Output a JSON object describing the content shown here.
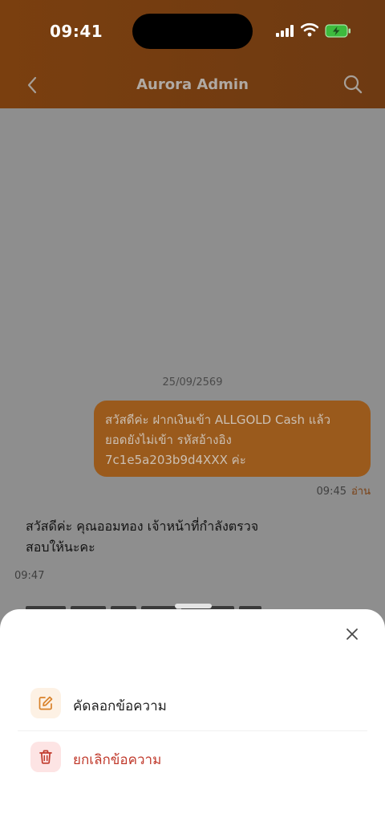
{
  "status_bar": {
    "time": "09:41"
  },
  "nav": {
    "title": "Aurora Admin"
  },
  "chat": {
    "date": "25/09/2569",
    "outgoing": {
      "lines": [
        "สวัสดีค่ะ ฝากเงินเข้า ALLGOLD Cash แล้ว",
        "ยอดยังไม่เข้า รหัสอ้างอิง",
        "7c1e5a203b9d4XXX ค่ะ"
      ],
      "time": "09:45",
      "read_label": "อ่าน"
    },
    "incoming": {
      "lines": [
        "สวัสดีค่ะ คุณออมทอง เจ้าหน้าที่กำลังตรวจ",
        "สอบให้นะคะ"
      ],
      "time": "09:47"
    }
  },
  "sheet": {
    "actions": [
      {
        "label": "คัดลอกข้อความ",
        "icon": "edit-icon"
      },
      {
        "label": "ยกเลิกข้อความ",
        "icon": "trash-icon"
      }
    ]
  },
  "colors": {
    "header": "#7a3f0f",
    "bubble_out": "#9a5a1c",
    "overlay": "#8e8e8e",
    "accent_orange": "#d9822b",
    "danger": "#c0392b"
  }
}
